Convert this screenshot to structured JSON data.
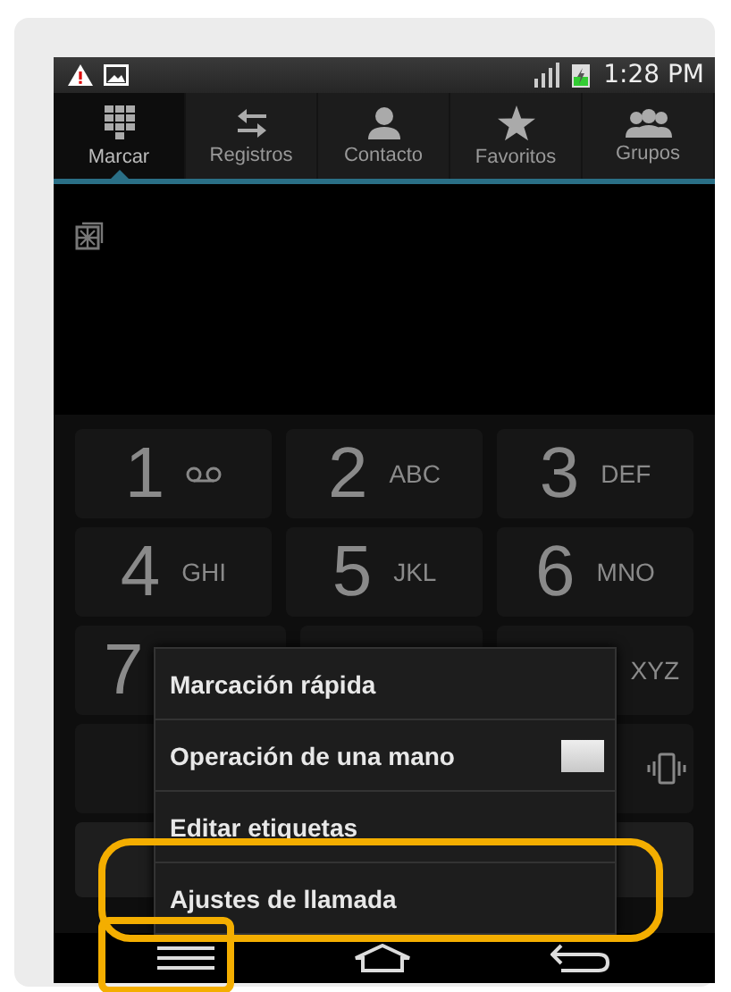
{
  "status_bar": {
    "time": "1:28 PM"
  },
  "tabs": [
    {
      "label": "Marcar",
      "kind": "dialpad",
      "selected": true
    },
    {
      "label": "Registros",
      "kind": "arrows",
      "selected": false
    },
    {
      "label": "Contacto",
      "kind": "person",
      "selected": false
    },
    {
      "label": "Favoritos",
      "kind": "star",
      "selected": false
    },
    {
      "label": "Grupos",
      "kind": "group",
      "selected": false
    }
  ],
  "keypad": {
    "rows": [
      [
        {
          "digit": "1",
          "kind": "voicemail"
        },
        {
          "digit": "2",
          "letters": "ABC"
        },
        {
          "digit": "3",
          "letters": "DEF"
        }
      ],
      [
        {
          "digit": "4",
          "letters": "GHI"
        },
        {
          "digit": "5",
          "letters": "JKL"
        },
        {
          "digit": "6",
          "letters": "MNO"
        }
      ],
      [
        {
          "digit": "7"
        },
        {},
        {
          "letters": "XYZ"
        }
      ],
      [
        {},
        {},
        {
          "kind": "vibrate"
        }
      ]
    ]
  },
  "menu": [
    {
      "label": "Marcación rápida",
      "kind": "text"
    },
    {
      "label": "Operación de una mano",
      "kind": "checkbox",
      "checked": false
    },
    {
      "label": "Editar etiquetas",
      "kind": "text"
    },
    {
      "label": "Ajustes de llamada",
      "kind": "text"
    }
  ]
}
